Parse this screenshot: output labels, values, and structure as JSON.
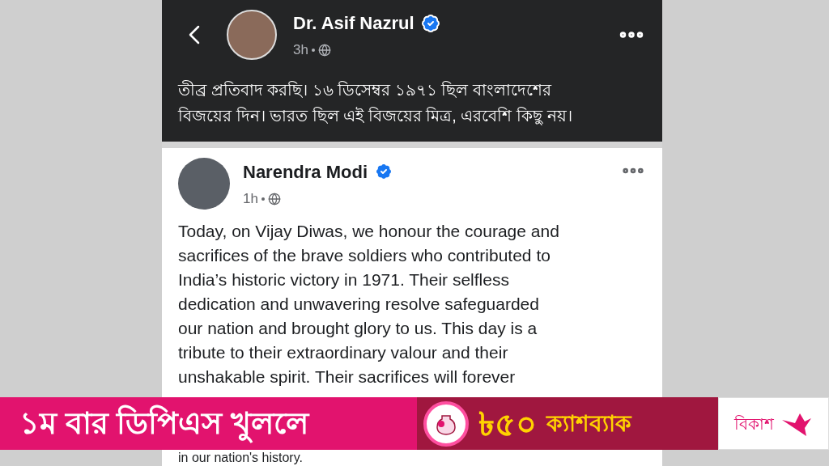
{
  "top_post": {
    "author": "Dr. Asif Nazrul",
    "verified": true,
    "time": "3h",
    "text_lines": [
      "তীব্র প্রতিবাদ করছি। ১৬ ডিসেম্বর ১৯৭১ ছিল বাংলাদেশের",
      "বিজয়ের দিন। ভারত ছিল এই বিজয়ের মিত্র, এরবেশি কিছু নয়।"
    ]
  },
  "quoted_post": {
    "author": "Narendra Modi",
    "verified": true,
    "time": "1h",
    "text_lines": [
      "Today, on Vijay Diwas, we honour the courage and",
      "sacrifices of the brave soldiers who contributed to",
      "India’s historic victory in 1971. Their selfless",
      "dedication and unwavering resolve safeguarded",
      "our nation and brought glory to us. This day is a",
      "tribute to their extraordinary valour and their",
      "unshakable spirit. Their sacrifices will forever"
    ],
    "text_tail": "in our nation's history."
  },
  "ad_banner": {
    "headline": "১ম বার ডিপিএস খুললে",
    "amount": "৳৫০",
    "offer": "ক্যাশব্যাক",
    "brand": "বিকাশ"
  }
}
